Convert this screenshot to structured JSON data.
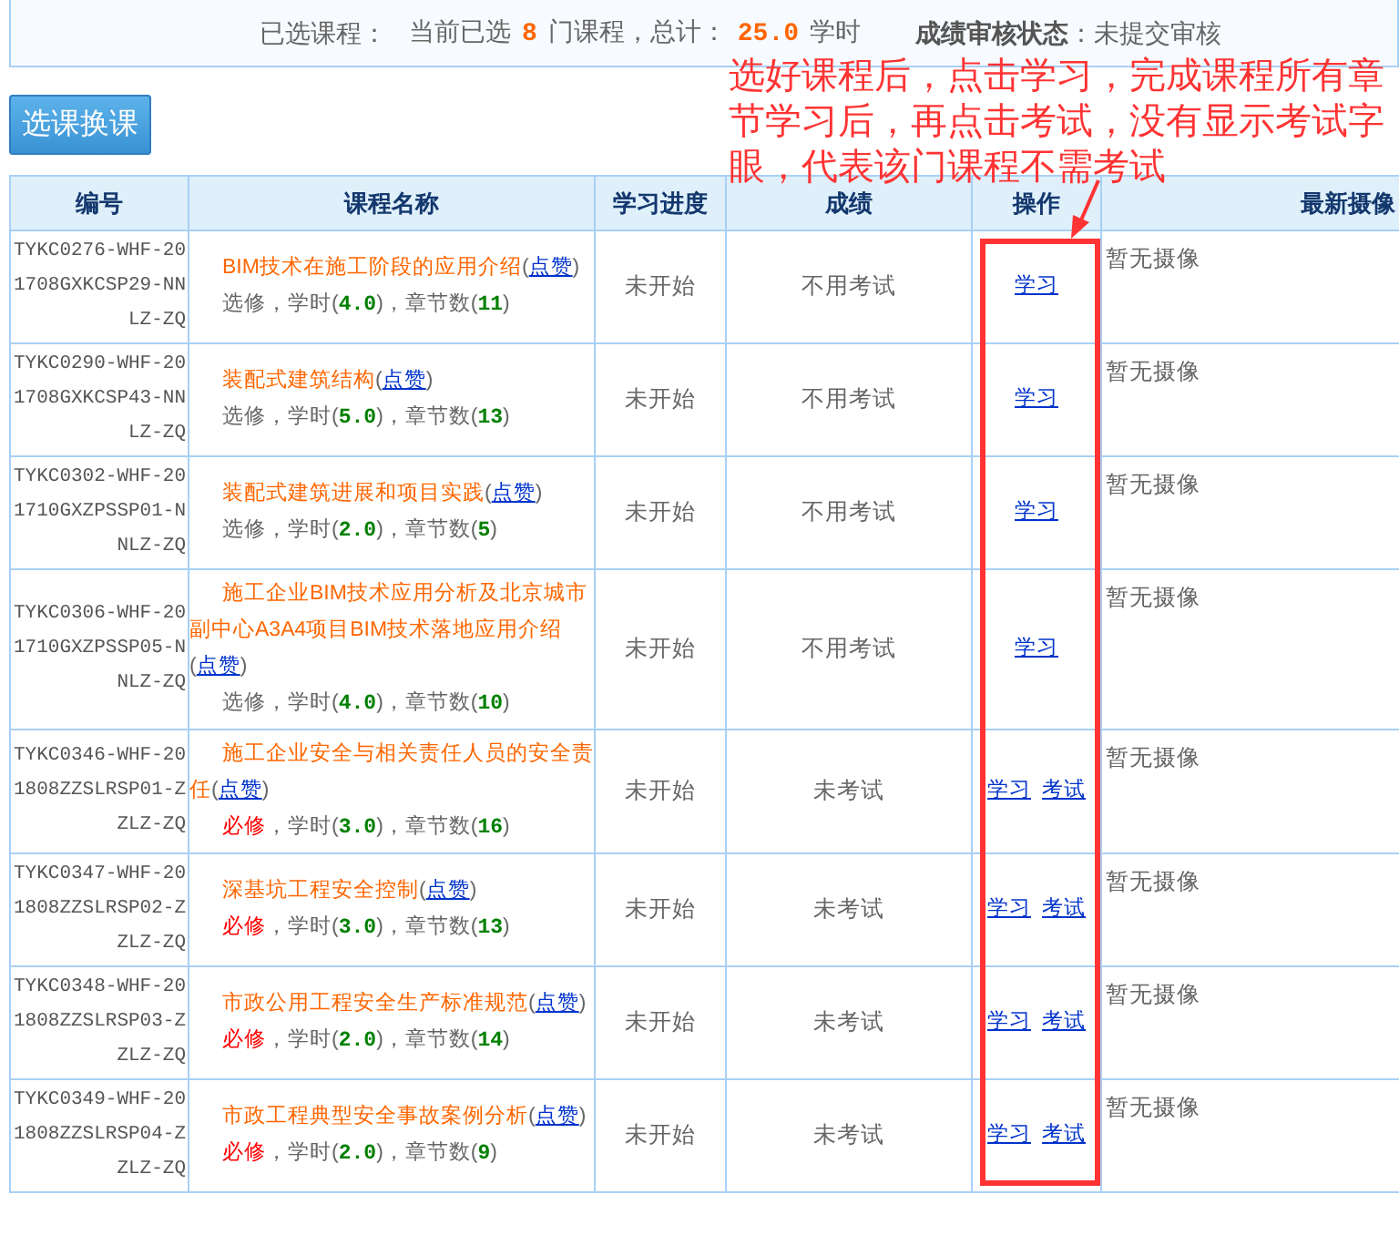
{
  "summary": {
    "label": "已选课程：",
    "parts": [
      {
        "kind": "plain",
        "text": "当前已选"
      },
      {
        "kind": "value",
        "text": "8"
      },
      {
        "kind": "plain",
        "text": "门课程，总计："
      },
      {
        "kind": "value",
        "text": "25.0"
      },
      {
        "kind": "plain",
        "text": "学时"
      }
    ],
    "status_label": "成绩审核状态",
    "status": "：未提交审核"
  },
  "button": "选课换课",
  "annotation": "选好课程后，点击学习，完成课程所有章节学习后，再点击考试，没有显示考试字眼，代表该门课程不需考试",
  "table": {
    "columns": [
      "编号",
      "课程名称",
      "学习进度",
      "成绩",
      "操作",
      "最新摄像"
    ],
    "rows": [
      {
        "code": "TYKC0276-WHF-201708GXKCSP29-NNLZ-ZQ",
        "title": [
          {
            "kind": "name",
            "text": "BIM技术在施工阶段的应用介绍"
          },
          {
            "kind": "plain",
            "text": "("
          },
          {
            "kind": "link",
            "text": "点赞"
          },
          {
            "kind": "plain",
            "text": ")"
          }
        ],
        "meta": [
          {
            "kind": "elective",
            "text": "选修"
          },
          {
            "kind": "plain",
            "text": "，学时("
          },
          {
            "kind": "value",
            "text": "4.0"
          },
          {
            "kind": "plain",
            "text": ")，章节数("
          },
          {
            "kind": "value",
            "text": "11"
          },
          {
            "kind": "plain",
            "text": ")"
          }
        ],
        "progress": "未开始",
        "score": "不用考试",
        "actions": [
          "学习"
        ],
        "camera": "暂无摄像"
      },
      {
        "code": "TYKC0290-WHF-201708GXKCSP43-NNLZ-ZQ",
        "title": [
          {
            "kind": "name",
            "text": "装配式建筑结构"
          },
          {
            "kind": "plain",
            "text": "("
          },
          {
            "kind": "link",
            "text": "点赞"
          },
          {
            "kind": "plain",
            "text": ")"
          }
        ],
        "meta": [
          {
            "kind": "elective",
            "text": "选修"
          },
          {
            "kind": "plain",
            "text": "，学时("
          },
          {
            "kind": "value",
            "text": "5.0"
          },
          {
            "kind": "plain",
            "text": ")，章节数("
          },
          {
            "kind": "value",
            "text": "13"
          },
          {
            "kind": "plain",
            "text": ")"
          }
        ],
        "progress": "未开始",
        "score": "不用考试",
        "actions": [
          "学习"
        ],
        "camera": "暂无摄像"
      },
      {
        "code": "TYKC0302-WHF-201710GXZPSSP01-NNLZ-ZQ",
        "title": [
          {
            "kind": "name",
            "text": "装配式建筑进展和项目实践"
          },
          {
            "kind": "plain",
            "text": "("
          },
          {
            "kind": "link",
            "text": "点赞"
          },
          {
            "kind": "plain",
            "text": ")"
          }
        ],
        "meta": [
          {
            "kind": "elective",
            "text": "选修"
          },
          {
            "kind": "plain",
            "text": "，学时("
          },
          {
            "kind": "value",
            "text": "2.0"
          },
          {
            "kind": "plain",
            "text": ")，章节数("
          },
          {
            "kind": "value",
            "text": "5"
          },
          {
            "kind": "plain",
            "text": ")"
          }
        ],
        "progress": "未开始",
        "score": "不用考试",
        "actions": [
          "学习"
        ],
        "camera": "暂无摄像"
      },
      {
        "code": "TYKC0306-WHF-201710GXZPSSP05-NNLZ-ZQ",
        "title": [
          {
            "kind": "name",
            "text": "施工企业BIM技术应用分析及北京城市副中心A3A4项目BIM技术落地应用介绍"
          },
          {
            "kind": "plain",
            "text": "("
          },
          {
            "kind": "link",
            "text": "点赞"
          },
          {
            "kind": "plain",
            "text": ")"
          }
        ],
        "meta": [
          {
            "kind": "elective",
            "text": "选修"
          },
          {
            "kind": "plain",
            "text": "，学时("
          },
          {
            "kind": "value",
            "text": "4.0"
          },
          {
            "kind": "plain",
            "text": ")，章节数("
          },
          {
            "kind": "value",
            "text": "10"
          },
          {
            "kind": "plain",
            "text": ")"
          }
        ],
        "progress": "未开始",
        "score": "不用考试",
        "actions": [
          "学习"
        ],
        "camera": "暂无摄像"
      },
      {
        "code": "TYKC0346-WHF-201808ZZSLRSP01-ZZLZ-ZQ",
        "title": [
          {
            "kind": "name",
            "text": "施工企业安全与相关责任人员的安全责任"
          },
          {
            "kind": "plain",
            "text": "("
          },
          {
            "kind": "link",
            "text": "点赞"
          },
          {
            "kind": "plain",
            "text": ")"
          }
        ],
        "meta": [
          {
            "kind": "required",
            "text": "必修"
          },
          {
            "kind": "plain",
            "text": "，学时("
          },
          {
            "kind": "value",
            "text": "3.0"
          },
          {
            "kind": "plain",
            "text": ")，章节数("
          },
          {
            "kind": "value",
            "text": "16"
          },
          {
            "kind": "plain",
            "text": ")"
          }
        ],
        "progress": "未开始",
        "score": "未考试",
        "actions": [
          "学习",
          "考试"
        ],
        "camera": "暂无摄像"
      },
      {
        "code": "TYKC0347-WHF-201808ZZSLRSP02-ZZLZ-ZQ",
        "title": [
          {
            "kind": "name",
            "text": "深基坑工程安全控制"
          },
          {
            "kind": "plain",
            "text": "("
          },
          {
            "kind": "link",
            "text": "点赞"
          },
          {
            "kind": "plain",
            "text": ")"
          }
        ],
        "meta": [
          {
            "kind": "required",
            "text": "必修"
          },
          {
            "kind": "plain",
            "text": "，学时("
          },
          {
            "kind": "value",
            "text": "3.0"
          },
          {
            "kind": "plain",
            "text": ")，章节数("
          },
          {
            "kind": "value",
            "text": "13"
          },
          {
            "kind": "plain",
            "text": ")"
          }
        ],
        "progress": "未开始",
        "score": "未考试",
        "actions": [
          "学习",
          "考试"
        ],
        "camera": "暂无摄像"
      },
      {
        "code": "TYKC0348-WHF-201808ZZSLRSP03-ZZLZ-ZQ",
        "title": [
          {
            "kind": "name",
            "text": "市政公用工程安全生产标准规范"
          },
          {
            "kind": "plain",
            "text": "("
          },
          {
            "kind": "link",
            "text": "点赞"
          },
          {
            "kind": "plain",
            "text": ")"
          }
        ],
        "meta": [
          {
            "kind": "required",
            "text": "必修"
          },
          {
            "kind": "plain",
            "text": "，学时("
          },
          {
            "kind": "value",
            "text": "2.0"
          },
          {
            "kind": "plain",
            "text": ")，章节数("
          },
          {
            "kind": "value",
            "text": "14"
          },
          {
            "kind": "plain",
            "text": ")"
          }
        ],
        "progress": "未开始",
        "score": "未考试",
        "actions": [
          "学习",
          "考试"
        ],
        "camera": "暂无摄像"
      },
      {
        "code": "TYKC0349-WHF-201808ZZSLRSP04-ZZLZ-ZQ",
        "title": [
          {
            "kind": "name",
            "text": "市政工程典型安全事故案例分析"
          },
          {
            "kind": "plain",
            "text": "("
          },
          {
            "kind": "link",
            "text": "点赞"
          },
          {
            "kind": "plain",
            "text": ")"
          }
        ],
        "meta": [
          {
            "kind": "required",
            "text": "必修"
          },
          {
            "kind": "plain",
            "text": "，学时("
          },
          {
            "kind": "value",
            "text": "2.0"
          },
          {
            "kind": "plain",
            "text": ")，章节数("
          },
          {
            "kind": "value",
            "text": "9"
          },
          {
            "kind": "plain",
            "text": ")"
          }
        ],
        "progress": "未开始",
        "score": "未考试",
        "actions": [
          "学习",
          "考试"
        ],
        "camera": "暂无摄像"
      }
    ]
  }
}
